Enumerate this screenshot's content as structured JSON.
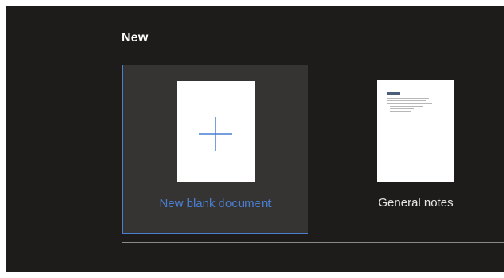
{
  "section": {
    "title": "New"
  },
  "templates": [
    {
      "label": "New blank document",
      "icon": "plus-icon"
    },
    {
      "label": "General notes",
      "icon": "document-thumbnail"
    }
  ],
  "colors": {
    "background": "#1e1c1b",
    "selected_card": "#363433",
    "accent": "#4a7fd0",
    "divider": "#8c8a89"
  }
}
